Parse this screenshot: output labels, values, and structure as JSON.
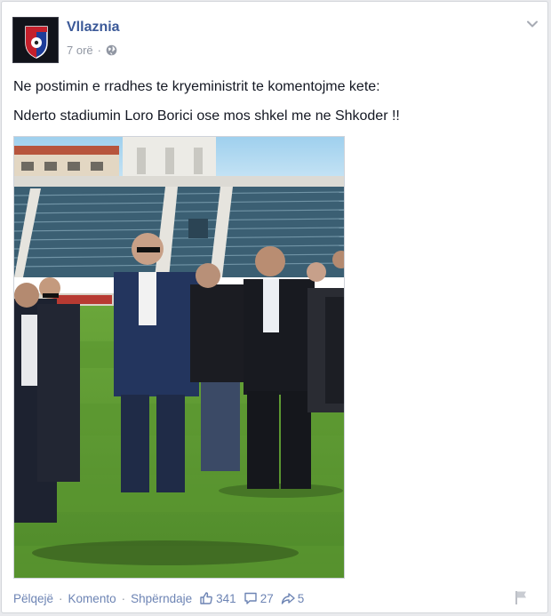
{
  "post": {
    "author": "Vllaznia",
    "time": "7 orë",
    "separator": "·",
    "privacy_icon": "globe-icon",
    "line1": "Ne postimin e rradhes te kryeministrit te komentojme kete:",
    "line2": "Nderto stadiumin Loro Borici ose mos shkel me ne Shkoder !!"
  },
  "actions": {
    "like": "Pëlqejë",
    "comment": "Komento",
    "share": "Shpërndaje",
    "separator": "·"
  },
  "stats": {
    "likes": "341",
    "comments": "27",
    "shares": "5"
  },
  "colors": {
    "brand_blue": "#3b5998",
    "link": "#6d84b4",
    "meta_gray": "#9197a3"
  }
}
